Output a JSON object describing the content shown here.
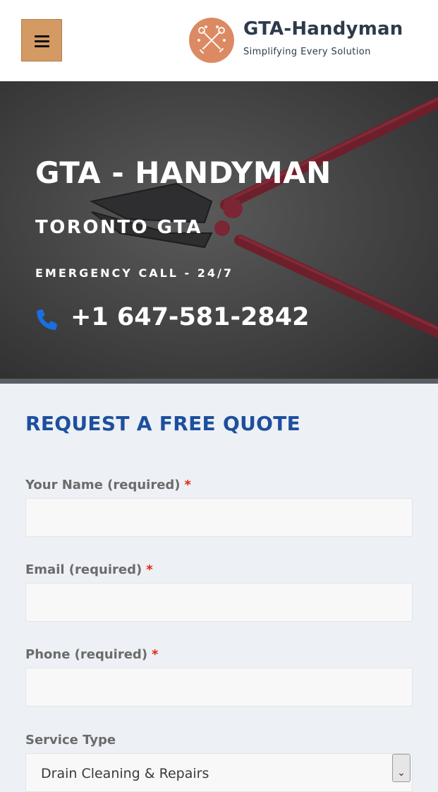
{
  "header": {
    "logo_title": "GTA-Handyman",
    "logo_tagline": "Simplifying Every Solution"
  },
  "hero": {
    "title": "GTA - HANDYMAN",
    "subtitle": "TORONTO GTA",
    "emergency": "EMERGENCY CALL - 24/7",
    "phone": "+1 647-581-2842"
  },
  "form": {
    "title": "REQUEST A FREE QUOTE",
    "name_label": "Your Name (required)",
    "email_label": "Email (required)",
    "phone_label": "Phone (required)",
    "service_label": "Service Type",
    "required_marker": "*",
    "service_selected": "Drain Cleaning & Repairs",
    "name_value": "",
    "email_value": "",
    "phone_value": ""
  },
  "colors": {
    "menu_button": "#d39a63",
    "logo_circle": "#dc8a63",
    "heading_blue": "#1d4f9e",
    "phone_icon": "#1a6fe0",
    "required": "#e0251a"
  },
  "icons": {
    "menu": "hamburger-icon",
    "logo": "tools-icon",
    "phone": "phone-icon",
    "select": "chevron-down-icon"
  }
}
